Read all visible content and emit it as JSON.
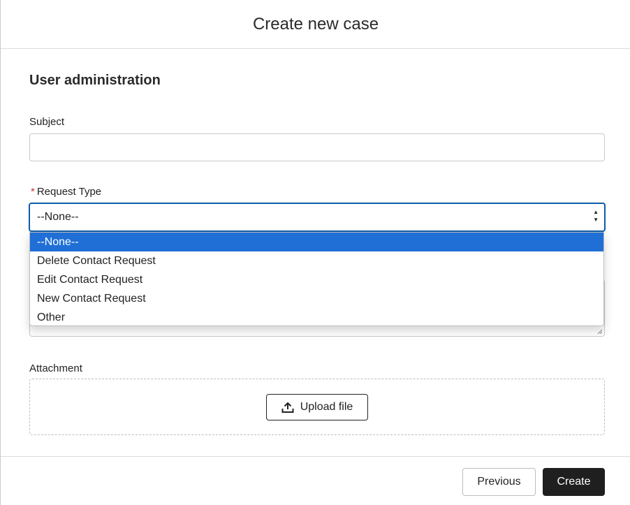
{
  "modal": {
    "title": "Create new case"
  },
  "form": {
    "section_title": "User administration",
    "subject": {
      "label": "Subject",
      "value": "",
      "placeholder": ""
    },
    "request_type": {
      "label": "Request Type",
      "required_marker": "*",
      "selected_value": "--None--",
      "options": [
        "--None--",
        "Delete Contact Request",
        "Edit Contact Request",
        "New Contact Request",
        "Other"
      ],
      "highlighted_index": 0
    },
    "attachment": {
      "label": "Attachment",
      "upload_label": "Upload file"
    }
  },
  "footer": {
    "previous_label": "Previous",
    "create_label": "Create"
  },
  "colors": {
    "focus_border": "#0b5cab",
    "option_highlight": "#1f6fd6",
    "required": "#c23934",
    "primary_button": "#1f1f1f"
  },
  "icons": {
    "upload": "upload-icon",
    "select_arrows": "sort-arrows-icon",
    "resize": "resize-handle-icon"
  }
}
